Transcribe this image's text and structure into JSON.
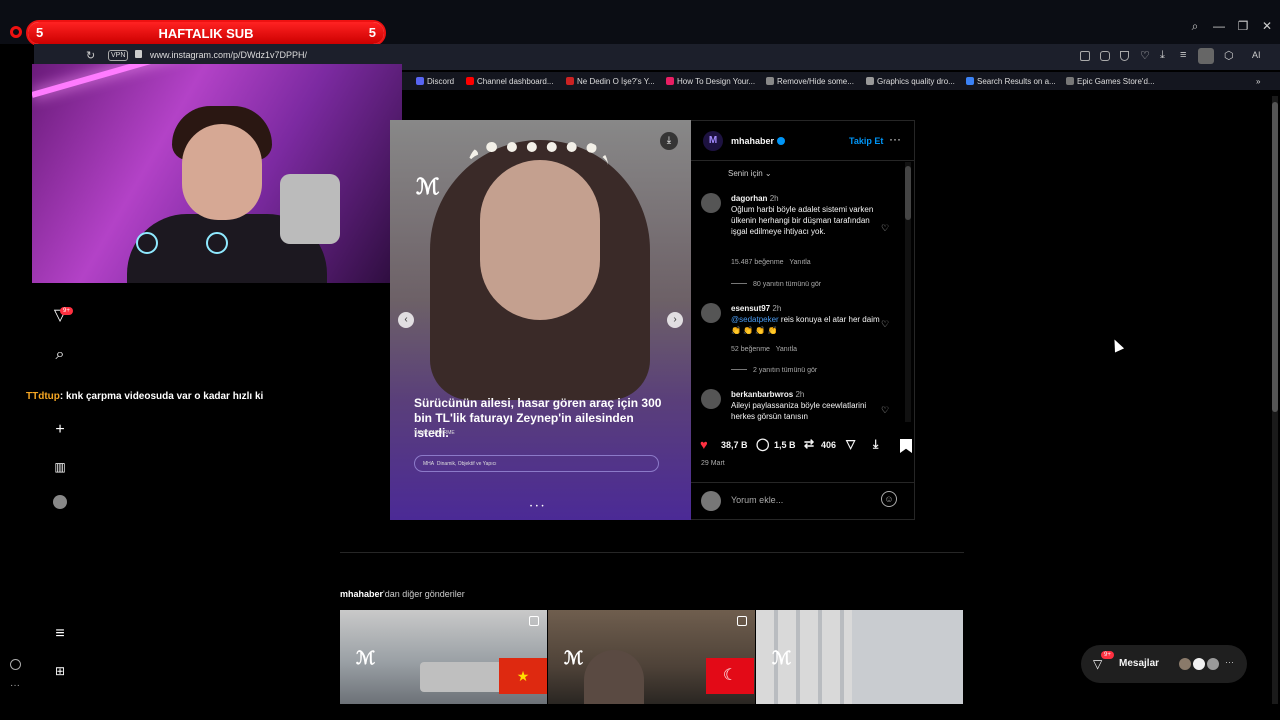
{
  "sub_bar": {
    "title": "HAFTALIK SUB",
    "left_count": "5",
    "right_count": "5"
  },
  "browser": {
    "url": "www.instagram.com/p/DWdz1v7DPPH/",
    "vpn_label": "VPN",
    "window_controls": [
      "search-icon",
      "minimize-icon",
      "restore-icon",
      "close-icon"
    ],
    "ai_label": "AI",
    "bookmarks": [
      {
        "label": "Discord",
        "color": "#5865f2"
      },
      {
        "label": "Channel dashboard...",
        "color": "#ff0000"
      },
      {
        "label": "Ne Dedin O İşe?'s Y...",
        "color": "#cc2222"
      },
      {
        "label": "How To Design Your...",
        "color": "#e91e63"
      },
      {
        "label": "Remove/Hide some...",
        "color": "#888888"
      },
      {
        "label": "Graphics quality dro...",
        "color": "#999999"
      },
      {
        "label": "Search Results on a...",
        "color": "#3b82f6"
      },
      {
        "label": "Epic Games Store'd...",
        "color": "#777777"
      }
    ],
    "bookmarks_more": "»"
  },
  "chat": {
    "user": "TTdtup",
    "message": ": knk çarpma videosuda var o kadar hızlı ki"
  },
  "left_nav": {
    "notification_badge": "9+",
    "icons": [
      "reels-icon",
      "explore-icon",
      "search-icon",
      "heart-icon",
      "create-icon",
      "dashboard-icon",
      "profile-avatar"
    ],
    "menu_icons": [
      "menu-icon",
      "apps-icon"
    ]
  },
  "post": {
    "caption": "Sürücünün ailesi, hasar gören araç için 300 bin TL'lik faturayı Zeynep'in ailesinden istedi.",
    "credit": "YANA KARDIRME",
    "footer_brand": "MHA",
    "footer_tagline": "Dinamik, Objektif ve Yapıcı",
    "logo": "ℳ",
    "prev": "‹",
    "next": "›",
    "download": "⤓",
    "dots": "• • •"
  },
  "side": {
    "username": "mhahaber",
    "avatar_letter": "M",
    "follow_label": "Takip Et",
    "more": "···",
    "for_you": "Senin için ⌄",
    "comments": [
      {
        "user": "dagorhan",
        "time": "2h",
        "text": "Oğlum harbi böyle adalet sistemi varken ülkenin herhangi bir düşman tarafından işgal edilmeye ihtiyacı yok.",
        "likes": "15.487 beğenme",
        "reply": "Yanıtla",
        "replies": "80 yanıtın tümünü gör"
      },
      {
        "user": "esensut97",
        "time": "2h",
        "mention": "@sedatpeker",
        "text": " reis konuya el atar her daim 👏 👏 👏 👏",
        "likes": "52 beğenme",
        "reply": "Yanıtla",
        "replies": "2 yanıtın tümünü gör"
      },
      {
        "user": "berkanbarbwros",
        "time": "2h",
        "text": "Aileyi paylassaniza böyle ceewlatlarini herkes görsün tanısın"
      }
    ],
    "actions": {
      "likes": "38,7 B",
      "comments": "1,5 B",
      "reposts": "406"
    },
    "date": "29 Mart",
    "comment_placeholder": "Yorum ekle..."
  },
  "more_posts": {
    "user": "mhahaber",
    "suffix": "'dan diğer gönderiler"
  },
  "messages": {
    "label": "Mesajlar",
    "badge": "9+"
  },
  "colors": {
    "accent": "#0095f6",
    "notify": "#ff3040",
    "sub_red": "#e11111",
    "purple": "#4b2a96"
  }
}
